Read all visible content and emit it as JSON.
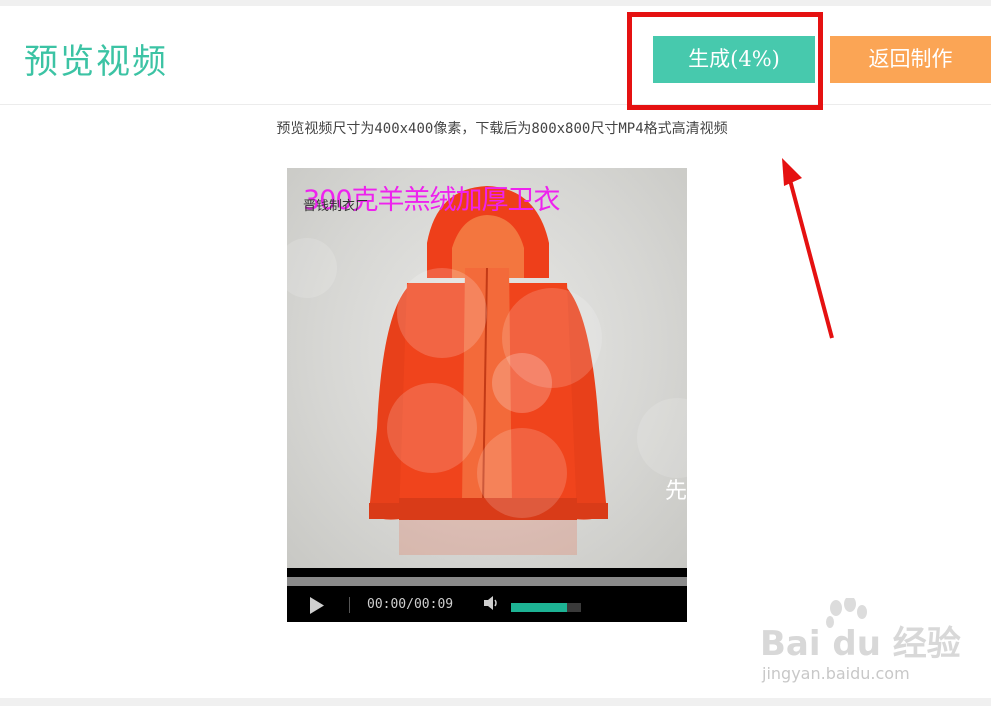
{
  "header": {
    "title": "预览视频",
    "generate_label": "生成(4%)",
    "generate_progress": 0.04,
    "back_label": "返回制作"
  },
  "hint_text": "预览视频尺寸为400x400像素，下载后为800x800尺寸MP4格式高清视频",
  "video": {
    "overlay_title": "300克羊羔绒加厚卫衣",
    "overlay_subtitle": "晋钱制衣厂",
    "edge_glyph": "先",
    "time_display": "00:00/00:09",
    "volume_level": 0.8,
    "accent_color": "#1db394",
    "product_color": "#f0441c"
  },
  "watermark": {
    "main": "Bai du 经验",
    "sub": "jingyan.baidu.com"
  },
  "colors": {
    "title": "#3cc3a4",
    "generate_button": "#47c9ad",
    "back_button": "#fba555",
    "annotation": "#e51111"
  }
}
